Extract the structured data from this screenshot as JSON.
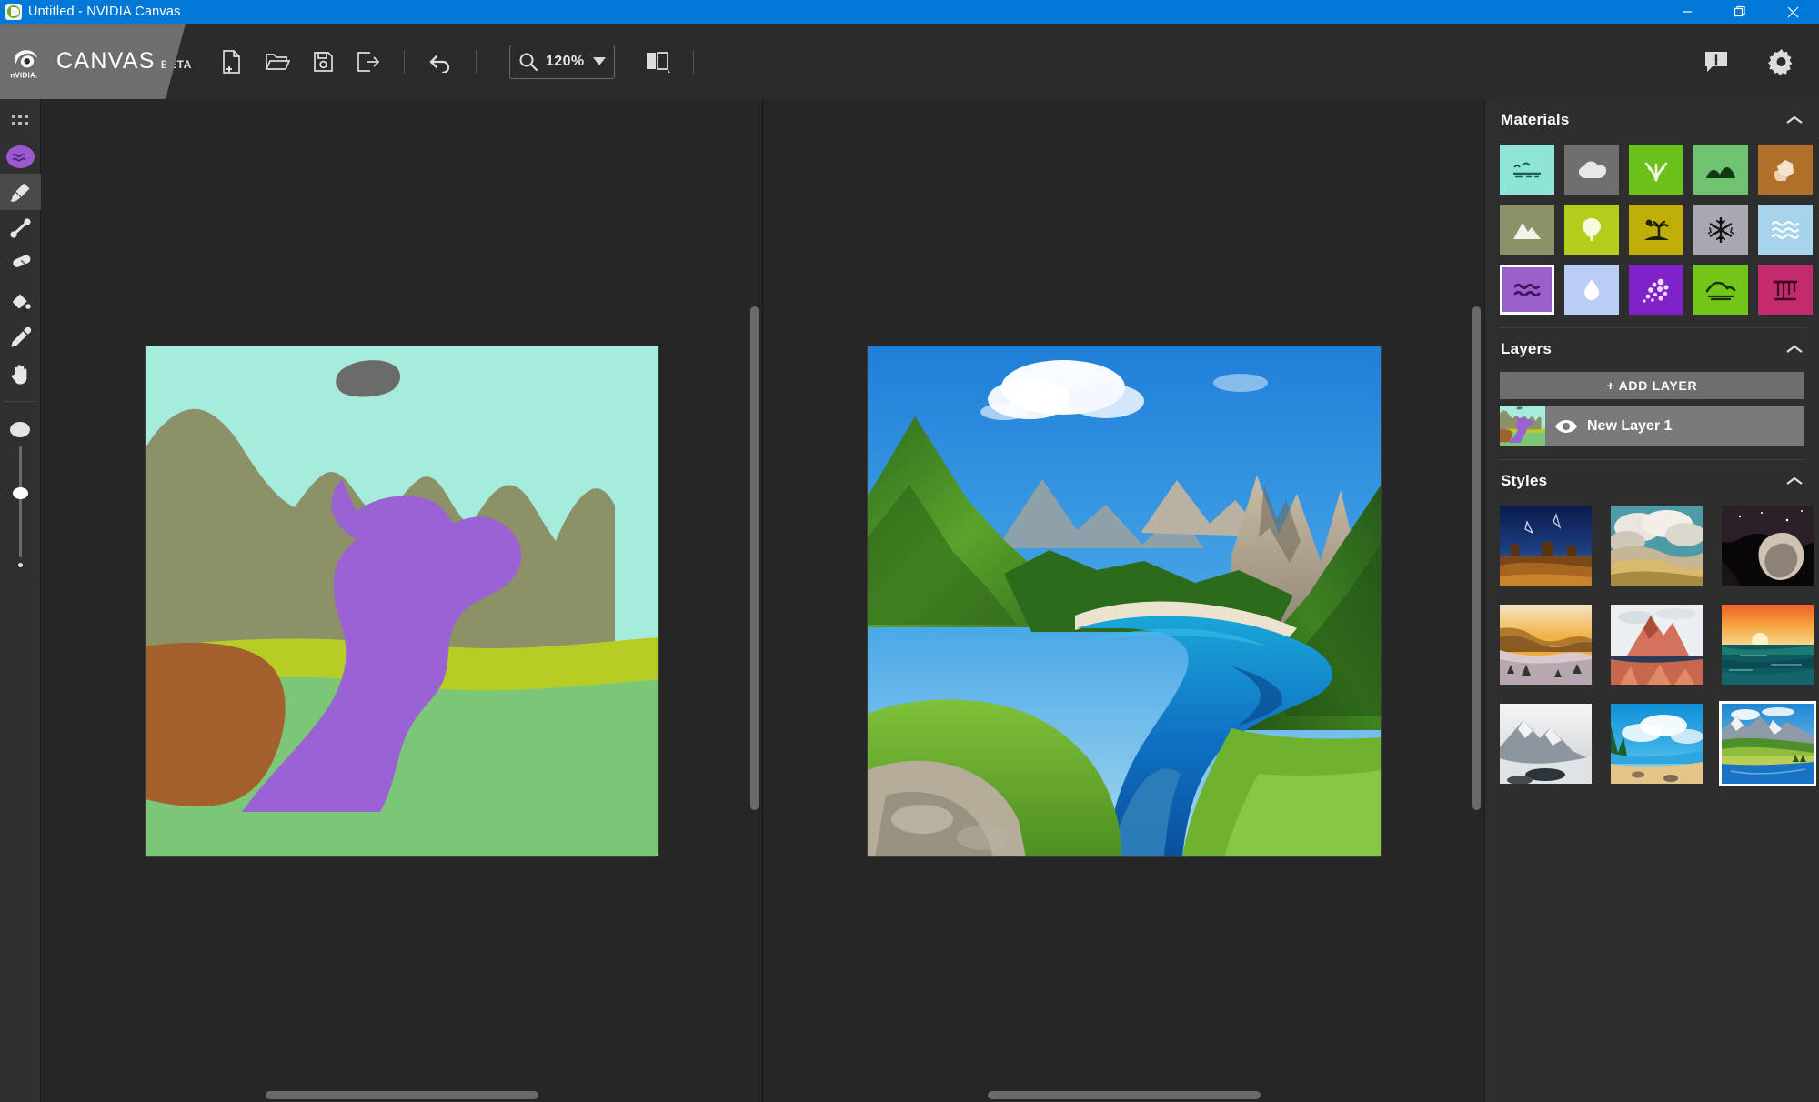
{
  "window": {
    "title": "Untitled - NVIDIA Canvas",
    "app_icon": "canvas-app-icon",
    "minimize": "−",
    "restore": "restore-icon",
    "close": "×"
  },
  "brand": {
    "logo": "nvidia-logo",
    "name": "CANVAS",
    "tag": "BETA"
  },
  "toolbar": {
    "new_label": "new-document-icon",
    "open_label": "open-folder-icon",
    "save_label": "save-disk-icon",
    "export_label": "export-icon",
    "undo_label": "undo-icon",
    "zoom_icon": "magnifier-icon",
    "zoom_value": "120%",
    "zoom_caret": "chevron-down-icon",
    "compare_label": "split-view-icon",
    "feedback_label": "feedback-icon",
    "settings_label": "gear-icon"
  },
  "tools": {
    "grid": "grid-icon",
    "material_swatch_color": "#9b59d0",
    "items": [
      {
        "name": "brush",
        "label": "Brush",
        "active": true
      },
      {
        "name": "line",
        "label": "Line",
        "active": false
      },
      {
        "name": "eraser",
        "label": "Eraser",
        "active": false
      },
      {
        "name": "fill",
        "label": "Paint Bucket",
        "active": false
      },
      {
        "name": "eyedropper",
        "label": "Eyedropper",
        "active": false
      },
      {
        "name": "pan",
        "label": "Pan Hand",
        "active": false
      }
    ],
    "brush_size_percent": 42
  },
  "materials": {
    "title": "Materials",
    "collapse_icon": "chevron-up-icon",
    "selected_index": 10,
    "items": [
      {
        "name": "sky",
        "label": "Sky",
        "color": "#8fe4d8",
        "icon": "sky-birds-icon",
        "ink": "#1f5f52"
      },
      {
        "name": "cloud",
        "label": "Cloud",
        "color": "#6f6f6f",
        "icon": "cloud-icon",
        "ink": "#e6e6e6"
      },
      {
        "name": "grass",
        "label": "Grass",
        "color": "#6bc119",
        "icon": "grass-icon",
        "ink": "#f0f7e2"
      },
      {
        "name": "bush",
        "label": "Bush",
        "color": "#6fc26f",
        "icon": "bush-hill-icon",
        "ink": "#113a14"
      },
      {
        "name": "dirt",
        "label": "Dirt",
        "color": "#b0702a",
        "icon": "rock-dirt-icon",
        "ink": "#f4e2cb"
      },
      {
        "name": "mountain",
        "label": "Mountain",
        "color": "#8b9168",
        "icon": "mountain-icon",
        "ink": "#f2f2ec"
      },
      {
        "name": "tree",
        "label": "Tree",
        "color": "#b4cd1c",
        "icon": "tree-icon",
        "ink": "#f6fbe0"
      },
      {
        "name": "sand",
        "label": "Sand",
        "color": "#bfae08",
        "icon": "palm-island-icon",
        "ink": "#1e1e06"
      },
      {
        "name": "snow",
        "label": "Snow",
        "color": "#a9a8b0",
        "icon": "snowflake-icon",
        "ink": "#15151a"
      },
      {
        "name": "sea",
        "label": "Sea",
        "color": "#a7d4ea",
        "icon": "sea-waves-icon",
        "ink": "#ffffff"
      },
      {
        "name": "water",
        "label": "Water",
        "color": "#9b5fc9",
        "icon": "water-waves-icon",
        "ink": "#3d1560"
      },
      {
        "name": "fog",
        "label": "Fog",
        "color": "#b9cdf5",
        "icon": "water-drop-icon",
        "ink": "#ffffff"
      },
      {
        "name": "flowers",
        "label": "Flowers",
        "color": "#7f22c7",
        "icon": "flowers-icon",
        "ink": "#f3ddff"
      },
      {
        "name": "hill",
        "label": "Hill",
        "color": "#74c519",
        "icon": "hill-icon",
        "ink": "#13330a"
      },
      {
        "name": "ruins",
        "label": "Ruins",
        "color": "#c42a6e",
        "icon": "ruins-icon",
        "ink": "#3d0a20"
      }
    ]
  },
  "layers": {
    "title": "Layers",
    "collapse_icon": "chevron-up-icon",
    "add_label": "+ ADD LAYER",
    "rows": [
      {
        "name": "New Layer 1",
        "visible": true,
        "eye_icon": "eye-icon"
      }
    ]
  },
  "styles": {
    "title": "Styles",
    "collapse_icon": "chevron-up-icon",
    "selected_index": 8,
    "items": [
      {
        "name": "style-mesa-storm",
        "label": "Mesa Storm"
      },
      {
        "name": "style-cumulus-cliffs",
        "label": "Cumulus Cliffs"
      },
      {
        "name": "style-night-cave",
        "label": "Night Cave"
      },
      {
        "name": "style-golden-fog",
        "label": "Golden Fog"
      },
      {
        "name": "style-red-dolomites",
        "label": "Red Dolomites"
      },
      {
        "name": "style-ocean-sunset",
        "label": "Ocean Sunset"
      },
      {
        "name": "style-ink-mountains",
        "label": "Ink Mountains"
      },
      {
        "name": "style-blue-shore",
        "label": "Blue Shore"
      },
      {
        "name": "style-alpine-lake",
        "label": "Alpine Lake"
      }
    ]
  },
  "canvas": {
    "segmentation": {
      "name": "segmentation-canvas",
      "zoom": "120%",
      "palette": {
        "sky": "#a6ecdc",
        "cloud": "#6b6b6b",
        "mountain": "#8d9168",
        "grass": "#b6cd26",
        "bush": "#7cc777",
        "dirt": "#a3602c",
        "water": "#9a62d4"
      }
    },
    "render": {
      "name": "rendered-canvas",
      "description": "Photorealistic alpine lake with green forested mountains, blue water and cloudy sky"
    },
    "scrollbars": {
      "vertical": "vertical-scrollbar",
      "horizontal": "horizontal-scrollbar"
    }
  }
}
